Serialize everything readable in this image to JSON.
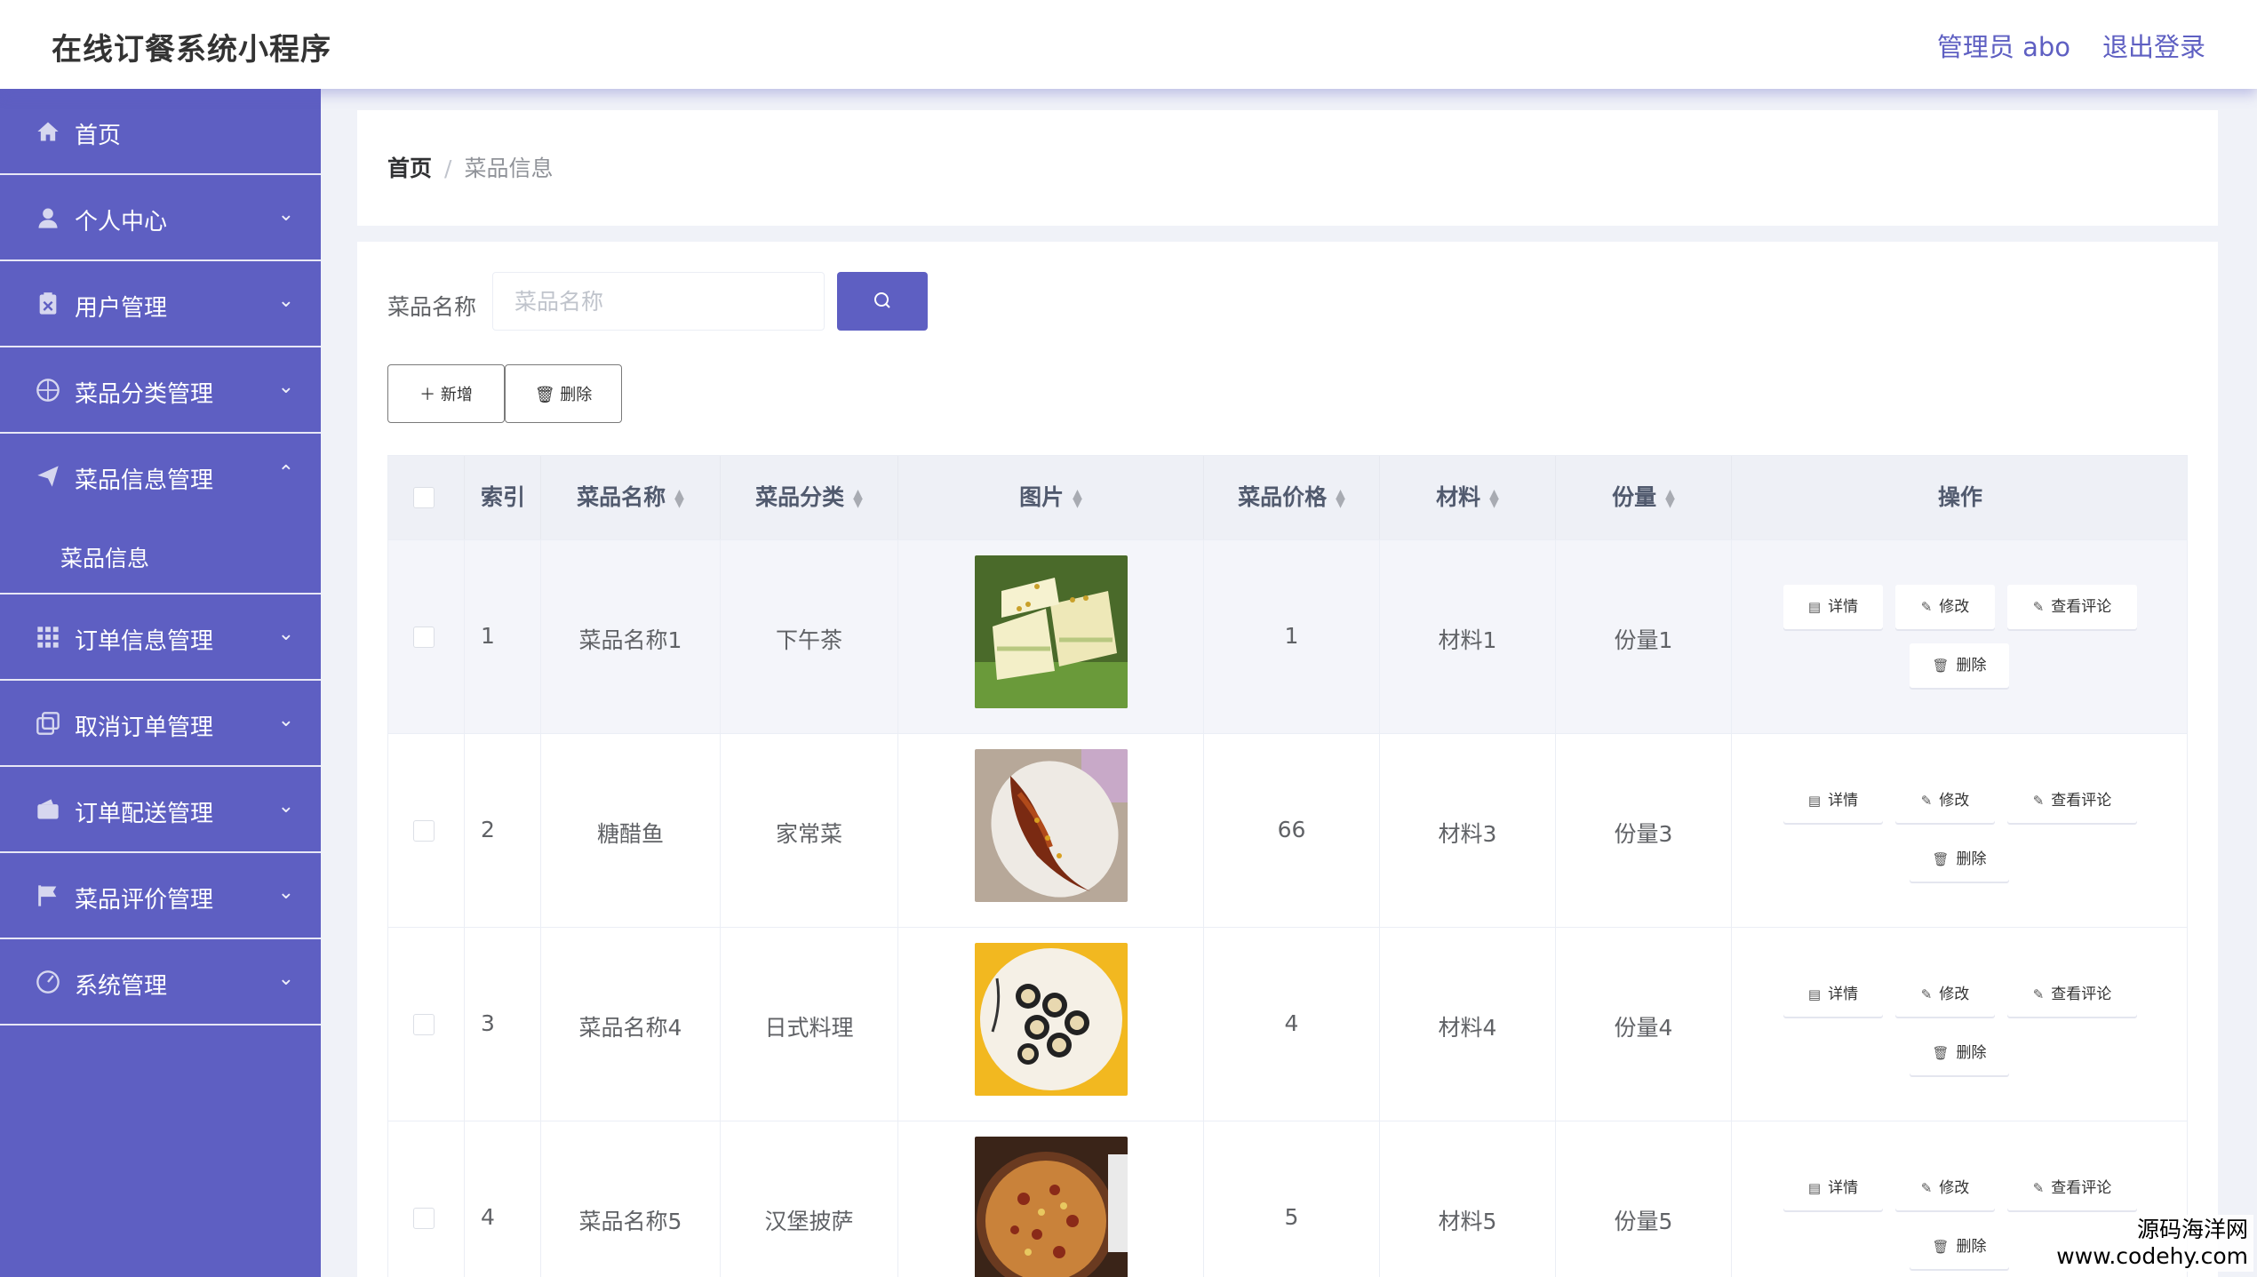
{
  "header": {
    "title": "在线订餐系统小程序",
    "admin": "管理员 abo",
    "logout": "退出登录"
  },
  "sidebar": {
    "items": [
      {
        "label": "首页",
        "icon": "home-icon",
        "has_arrow": false
      },
      {
        "label": "个人中心",
        "icon": "user-icon",
        "has_arrow": true
      },
      {
        "label": "用户管理",
        "icon": "clipboard-icon",
        "has_arrow": true
      },
      {
        "label": "菜品分类管理",
        "icon": "compass-icon",
        "has_arrow": true
      },
      {
        "label": "菜品信息管理",
        "icon": "send-icon",
        "has_arrow": true,
        "open": true
      },
      {
        "label": "订单信息管理",
        "icon": "grid-icon",
        "has_arrow": true
      },
      {
        "label": "取消订单管理",
        "icon": "copy-icon",
        "has_arrow": true
      },
      {
        "label": "订单配送管理",
        "icon": "wallet-icon",
        "has_arrow": true
      },
      {
        "label": "菜品评价管理",
        "icon": "flag-icon",
        "has_arrow": true
      },
      {
        "label": "系统管理",
        "icon": "gauge-icon",
        "has_arrow": true
      }
    ],
    "submenu": [
      {
        "label": "菜品信息"
      }
    ]
  },
  "breadcrumb": {
    "home": "首页",
    "separator": "/",
    "current": "菜品信息"
  },
  "search": {
    "label": "菜品名称",
    "placeholder": "菜品名称",
    "value": ""
  },
  "toolbar": {
    "add_label": "新增",
    "delete_label": "删除"
  },
  "table": {
    "columns": [
      "索引",
      "菜品名称",
      "菜品分类",
      "图片",
      "菜品价格",
      "材料",
      "份量",
      "操作"
    ],
    "actions": {
      "detail": "详情",
      "edit": "修改",
      "review": "查看评论",
      "delete": "删除"
    },
    "rows": [
      {
        "index": "1",
        "name": "菜品名称1",
        "category": "下午茶",
        "image": "dessert-photo",
        "price": "1",
        "material": "材料1",
        "portion": "份量1"
      },
      {
        "index": "2",
        "name": "糖醋鱼",
        "category": "家常菜",
        "image": "fish-photo",
        "price": "66",
        "material": "材料3",
        "portion": "份量3"
      },
      {
        "index": "3",
        "name": "菜品名称4",
        "category": "日式料理",
        "image": "sushi-photo",
        "price": "4",
        "material": "材料4",
        "portion": "份量4"
      },
      {
        "index": "4",
        "name": "菜品名称5",
        "category": "汉堡披萨",
        "image": "pizza-photo",
        "price": "5",
        "material": "材料5",
        "portion": "份量5"
      }
    ]
  },
  "watermark": {
    "line1": "源码海洋网",
    "line2": "www.codehy.com"
  },
  "colors": {
    "primary": "#5e5fc2",
    "header_bg": "#ffffff",
    "page_bg": "#f0f2f8"
  }
}
